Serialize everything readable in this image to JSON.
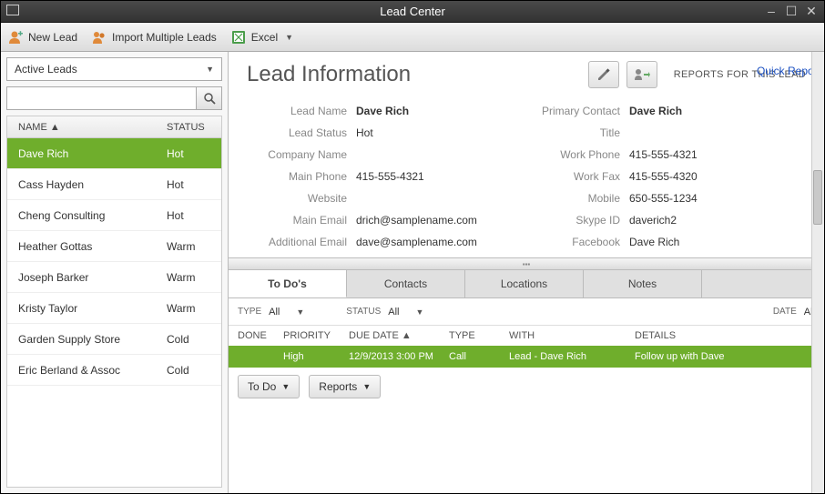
{
  "window": {
    "title": "Lead Center"
  },
  "toolbar": {
    "new_lead": "New Lead",
    "import": "Import Multiple Leads",
    "excel": "Excel"
  },
  "leadList": {
    "filter": "Active Leads",
    "columns": {
      "name": "NAME ▲",
      "status": "STATUS"
    },
    "rows": [
      {
        "name": "Dave Rich",
        "status": "Hot",
        "selected": true
      },
      {
        "name": "Cass Hayden",
        "status": "Hot"
      },
      {
        "name": "Cheng Consulting",
        "status": "Hot"
      },
      {
        "name": "Heather Gottas",
        "status": "Warm"
      },
      {
        "name": "Joseph Barker",
        "status": "Warm"
      },
      {
        "name": "Kristy Taylor",
        "status": "Warm"
      },
      {
        "name": "Garden Supply Store",
        "status": "Cold"
      },
      {
        "name": "Eric Berland & Assoc",
        "status": "Cold"
      }
    ]
  },
  "info": {
    "heading": "Lead Information",
    "reports_for": "REPORTS FOR THIS LEAD",
    "quick_report": "Quick Report",
    "labels": {
      "lead_name": "Lead Name",
      "lead_status": "Lead Status",
      "company_name": "Company Name",
      "main_phone": "Main Phone",
      "website": "Website",
      "main_email": "Main Email",
      "additional_email": "Additional Email",
      "primary_contact": "Primary Contact",
      "title": "Title",
      "work_phone": "Work Phone",
      "work_fax": "Work Fax",
      "mobile": "Mobile",
      "skype_id": "Skype ID",
      "facebook": "Facebook"
    },
    "values": {
      "lead_name": "Dave Rich",
      "lead_status": "Hot",
      "company_name": "",
      "main_phone": "415-555-4321",
      "website": "",
      "main_email": "drich@samplename.com",
      "additional_email": "dave@samplename.com",
      "primary_contact": "Dave  Rich",
      "title": "",
      "work_phone": "415-555-4321",
      "work_fax": "415-555-4320",
      "mobile": "650-555-1234",
      "skype_id": "daverich2",
      "facebook": "Dave Rich"
    }
  },
  "tabs": {
    "items": [
      "To Do's",
      "Contacts",
      "Locations",
      "Notes"
    ],
    "active": 0
  },
  "todo": {
    "filters": {
      "type_label": "TYPE",
      "type_value": "All",
      "status_label": "STATUS",
      "status_value": "All",
      "date_label": "DATE",
      "date_value": "All"
    },
    "columns": {
      "done": "DONE",
      "priority": "PRIORITY",
      "due": "DUE DATE ▲",
      "type": "TYPE",
      "with": "WITH",
      "details": "DETAILS"
    },
    "rows": [
      {
        "done": "",
        "priority": "High",
        "due": "12/9/2013 3:00 PM",
        "type": "Call",
        "with": "Lead - Dave Rich",
        "details": "Follow up with Dave"
      }
    ],
    "buttons": {
      "todo": "To Do",
      "reports": "Reports"
    }
  }
}
